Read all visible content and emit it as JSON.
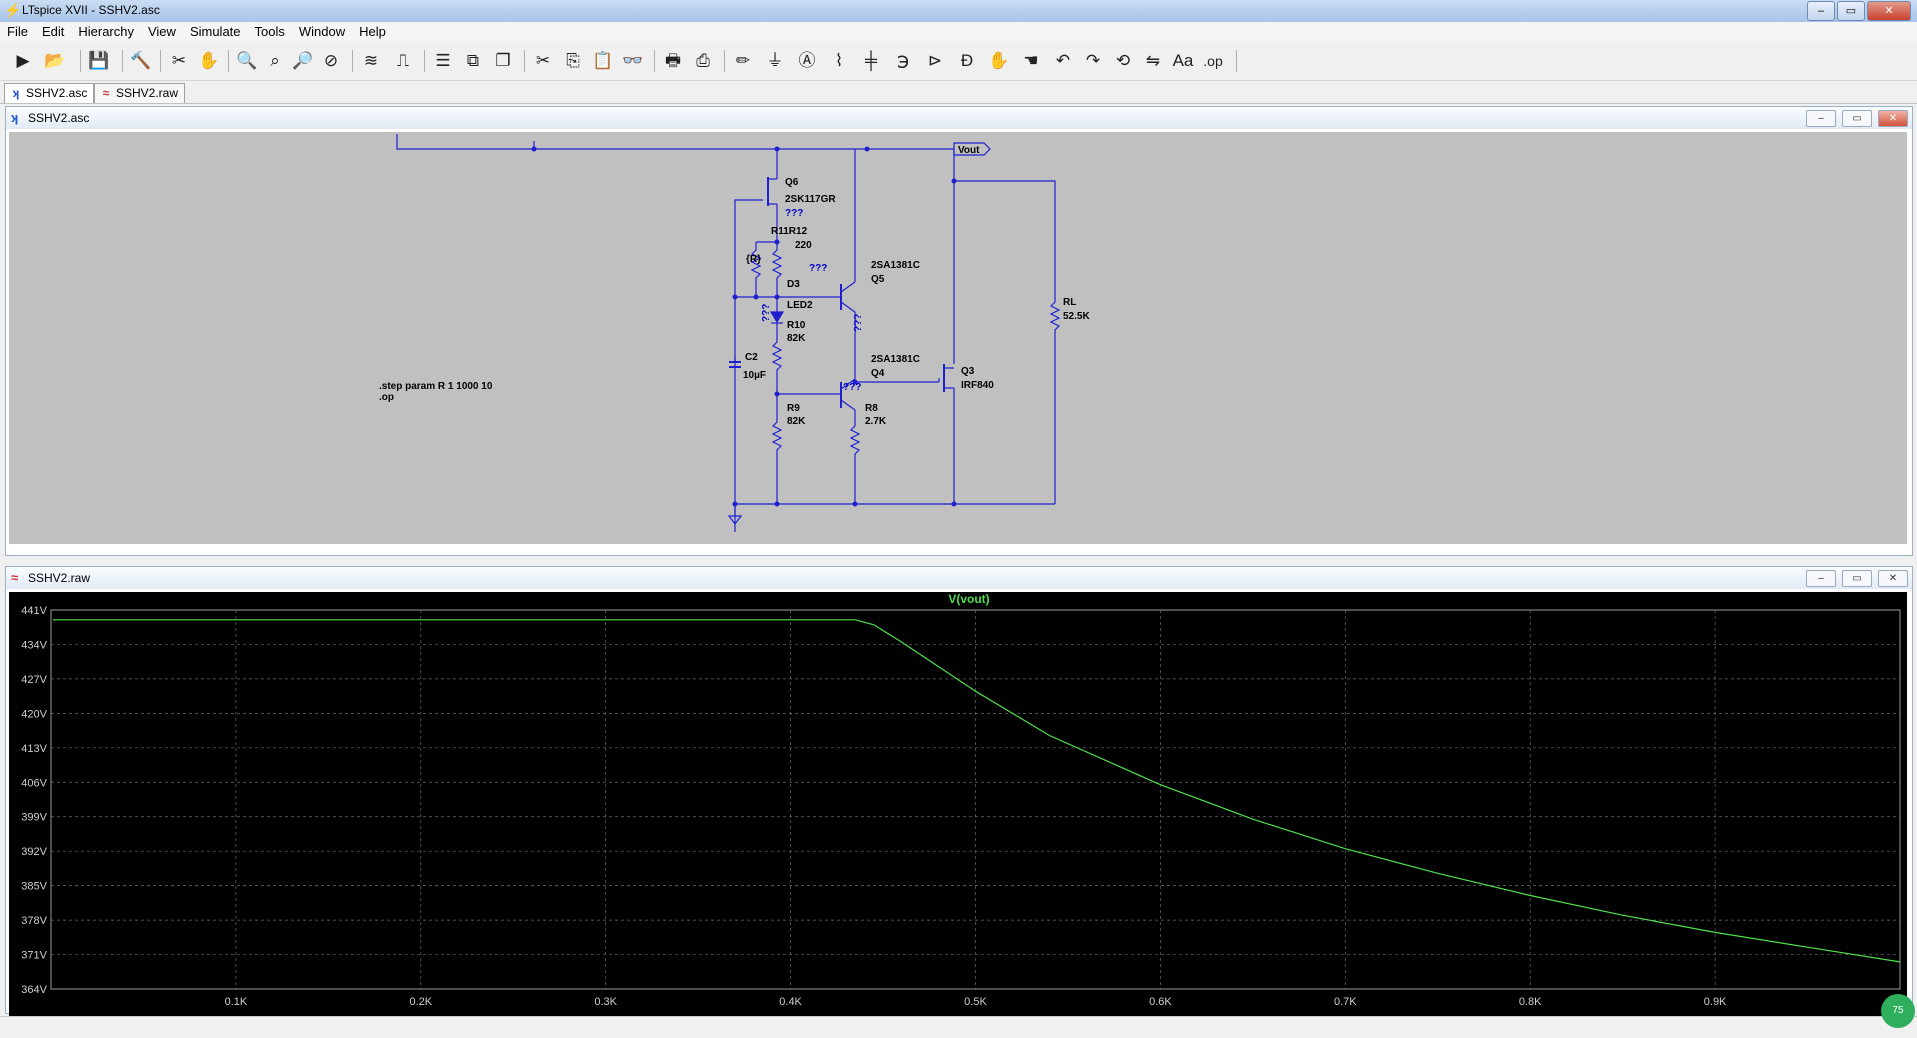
{
  "window": {
    "title": "LTspice XVII - SSHV2.asc",
    "minimize": "–",
    "restore": "▭",
    "close": "✕"
  },
  "menu": [
    "File",
    "Edit",
    "Hierarchy",
    "View",
    "Simulate",
    "Tools",
    "Window",
    "Help"
  ],
  "tabs": [
    {
      "label": "SSHV2.asc",
      "icon": "schematic-tab-icon"
    },
    {
      "label": "SSHV2.raw",
      "icon": "waveform-tab-icon"
    }
  ],
  "schematic_window": {
    "title": "SSHV2.asc",
    "directive_line1": ".step param R 1 1000 10",
    "directive_line2": ".op",
    "net_label": "Vout",
    "components": {
      "q6_name": "Q6",
      "q6_value": "2SK117GR",
      "r11r12_name": "R11R12",
      "r12_value": "220",
      "r11_value": "{R}",
      "q5_value": "2SA1381C",
      "q5_name": "Q5",
      "d3_name": "D3",
      "d3_value": "LED2",
      "r10_name": "R10",
      "r10_value": "82K",
      "c2_name": "C2",
      "c2_value": "10µF",
      "q4_value": "2SA1381C",
      "q4_name": "Q4",
      "q3_name": "Q3",
      "q3_value": "IRF840",
      "r9_name": "R9",
      "r9_value": "82K",
      "r8_name": "R8",
      "r8_value": "2.7K",
      "rl_name": "RL",
      "rl_value": "52.5K",
      "unknown": "???"
    }
  },
  "waveform_window": {
    "title": "SSHV2.raw",
    "trace_label": "V(vout)",
    "trace_color": "#4fe04f",
    "badge": "75"
  },
  "chart_data": {
    "type": "line",
    "title": "V(vout)",
    "xlabel": "",
    "ylabel": "",
    "xlim": [
      0,
      1000
    ],
    "ylim": [
      364,
      441
    ],
    "x_ticks": [
      "0.1K",
      "0.2K",
      "0.3K",
      "0.4K",
      "0.5K",
      "0.6K",
      "0.7K",
      "0.8K",
      "0.9K"
    ],
    "x_tick_values": [
      100,
      200,
      300,
      400,
      500,
      600,
      700,
      800,
      900
    ],
    "y_ticks": [
      "441V",
      "434V",
      "427V",
      "420V",
      "413V",
      "406V",
      "399V",
      "392V",
      "385V",
      "378V",
      "371V",
      "364V"
    ],
    "y_tick_values": [
      441,
      434,
      427,
      420,
      413,
      406,
      399,
      392,
      385,
      378,
      371,
      364
    ],
    "grid": true,
    "series": [
      {
        "name": "V(vout)",
        "x": [
          1,
          100,
          200,
          300,
          400,
          435,
          445,
          460,
          500,
          540,
          600,
          650,
          700,
          750,
          800,
          850,
          900,
          950,
          1000
        ],
        "y": [
          439,
          439,
          439,
          439,
          439,
          439,
          438,
          434.5,
          424.5,
          415.5,
          405.5,
          398.5,
          392.5,
          387.5,
          383,
          379,
          375.5,
          372.5,
          369.5
        ]
      }
    ]
  }
}
